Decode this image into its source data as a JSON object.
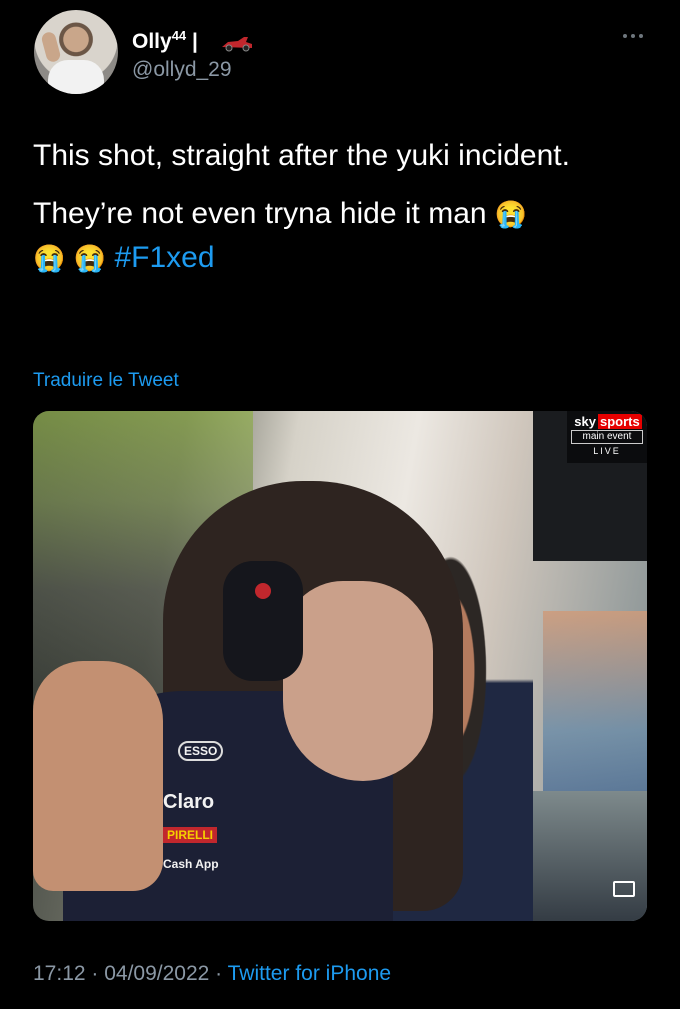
{
  "author": {
    "display_name": "Olly",
    "display_name_sup": "44",
    "separator": "|",
    "handle": "@ollyd_29"
  },
  "icons": {
    "more": "more-options-icon",
    "car": "race-car-icon",
    "emoji": "loudly-crying-face"
  },
  "tweet": {
    "line1": "This shot, straight after the yuki incident.",
    "line2_text": "They’re not even tryna hide it man",
    "emoji": "😭",
    "hashtag": "#F1xed"
  },
  "translate_label": "Traduire le Tweet",
  "media": {
    "sponsors": [
      "ESSO",
      "Claro",
      "PIRELLI",
      "Cash App"
    ],
    "watermark": {
      "brand_left": "sky",
      "brand_right": "sports",
      "channel": "main event",
      "status": "LIVE"
    }
  },
  "meta": {
    "time": "17:12",
    "dot1": " · ",
    "date": "04/09/2022",
    "dot2": " · ",
    "source": "Twitter for iPhone"
  },
  "colors": {
    "background": "#000000",
    "link": "#1d9bf0",
    "secondary_text": "#8b98a5",
    "text": "#ffffff"
  }
}
